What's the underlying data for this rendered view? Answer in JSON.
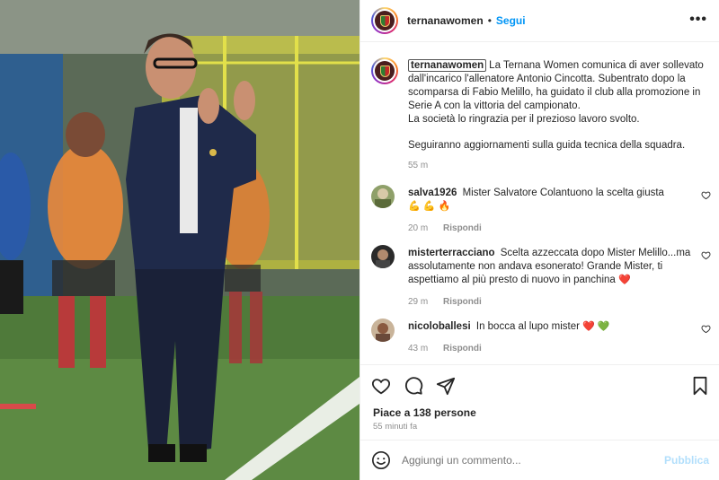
{
  "header": {
    "username": "ternanawomen",
    "separator": "•",
    "follow_label": "Segui",
    "more_icon": "more-horizontal-icon"
  },
  "caption": {
    "username": "ternanawomen",
    "text1": "La Ternana Women comunica di aver sollevato dall'incarico l'allenatore Antonio Cincotta. Subentrato dopo la scomparsa di Fabio Melillo, ha guidato il club alla promozione in Serie A con la vittoria del campionato.",
    "text2": "La società lo ringrazia per il prezioso lavoro svolto.",
    "text3": "Seguiranno aggiornamenti sulla guida tecnica della squadra.",
    "time": "55 m"
  },
  "comments": [
    {
      "username": "salva1926",
      "text": "Mister Salvatore Colantuono la scelta giusta",
      "emojis": "💪 💪 🔥",
      "time": "20 m",
      "reply_label": "Rispondi"
    },
    {
      "username": "misterterracciano",
      "text": "Scelta azzeccata dopo Mister Melillo...ma assolutamente non andava esonerato! Grande Mister, ti aspettiamo al più presto di nuovo in panchina",
      "emojis": "❤️",
      "time": "29 m",
      "reply_label": "Rispondi"
    },
    {
      "username": "nicoloballesi",
      "text": "In bocca al lupo mister",
      "emojis": "❤️ 💚",
      "time": "43 m",
      "reply_label": "Rispondi"
    }
  ],
  "actions": {
    "likes": "Piace a 138 persone",
    "ago": "55 minuti fa"
  },
  "add_comment": {
    "placeholder": "Aggiungi un commento...",
    "publish_label": "Pubblica"
  },
  "colors": {
    "accent": "#0095f6",
    "publish_disabled": "#b2dffc",
    "muted": "#8e8e8e",
    "text": "#262626"
  }
}
